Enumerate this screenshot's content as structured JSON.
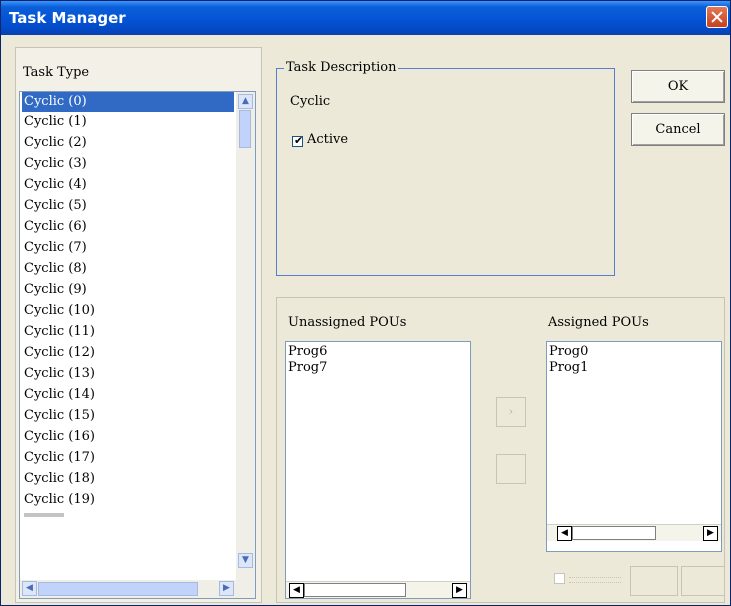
{
  "window": {
    "title": "Task Manager"
  },
  "task_type": {
    "label": "Task Type",
    "items": [
      "Cyclic (0)",
      "Cyclic (1)",
      "Cyclic (2)",
      "Cyclic (3)",
      "Cyclic (4)",
      "Cyclic (5)",
      "Cyclic (6)",
      "Cyclic (7)",
      "Cyclic (8)",
      "Cyclic (9)",
      "Cyclic (10)",
      "Cyclic (11)",
      "Cyclic (12)",
      "Cyclic (13)",
      "Cyclic (14)",
      "Cyclic (15)",
      "Cyclic (16)",
      "Cyclic (17)",
      "Cyclic (18)",
      "Cyclic (19)"
    ],
    "selected": "Cyclic (0)"
  },
  "task_description": {
    "legend": "Task Description",
    "type_text": "Cyclic",
    "active_label": "Active",
    "active_checked": true
  },
  "buttons": {
    "ok": "OK",
    "cancel": "Cancel"
  },
  "unassigned_pous": {
    "label": "Unassigned POUs",
    "items": [
      "Prog6",
      "Prog7"
    ]
  },
  "assigned_pous": {
    "label": "Assigned POUs",
    "items": [
      "Prog0",
      "Prog1"
    ]
  },
  "colors": {
    "title_bar": "#0453d6",
    "selection": "#316ac5",
    "dialog_bg": "#ece9d8"
  },
  "icons": {
    "close": "close-icon",
    "scroll_up": "arrow-up-icon",
    "scroll_down": "arrow-down-icon",
    "scroll_left": "arrow-left-icon",
    "scroll_right": "arrow-right-icon",
    "move_right": "arrow-right-icon",
    "move_left": "arrow-left-icon"
  }
}
